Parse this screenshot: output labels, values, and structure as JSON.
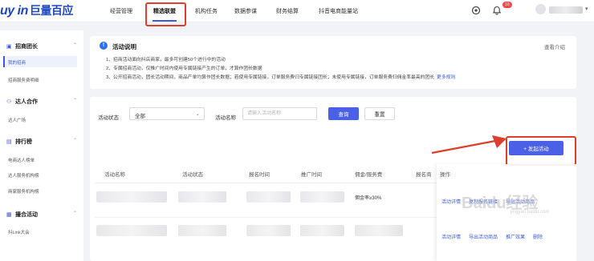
{
  "brand": {
    "logo_text": "uy in",
    "logo_cn": "巨量百应"
  },
  "nav": {
    "items": [
      {
        "label": "经营管理"
      },
      {
        "label": "精选联盟"
      },
      {
        "label": "机构任务"
      },
      {
        "label": "数据参谋"
      },
      {
        "label": "财务结算"
      },
      {
        "label": "抖音电商能量站"
      }
    ],
    "active_index": 1
  },
  "header": {
    "icons": [
      "target-icon",
      "bell-icon"
    ],
    "badge": "10",
    "avatar_icon": "user-icon"
  },
  "sidebar": {
    "groups": [
      {
        "icon": "user-group-icon",
        "label": "招商团长",
        "items": [
          "我的招商",
          "招商服务费明细"
        ]
      },
      {
        "icon": "handshake-icon",
        "label": "达人合作",
        "items": [
          "达人广场"
        ]
      },
      {
        "icon": "ranking-icon",
        "label": "排行榜",
        "items": [
          "电商达人榜单",
          "达人服务机构榜",
          "商家服务机构榜"
        ]
      },
      {
        "icon": "match-icon",
        "label": "撮合活动",
        "items": [
          "抖Link大会"
        ]
      }
    ],
    "active_item": "我的招商"
  },
  "notice": {
    "title": "活动说明",
    "right_link": "查看介绍",
    "lines": [
      "1、招商活动面向抖店商家，最多可创建50个进行中的活动",
      "2、专属招商活动，仅推广时间内使用专属链接产生的订单，才算作团长数据",
      "3、公开招商活动，团长活动期间，商品产单均算作团长数据；若使用专属链接，订单服务费归专属链接团长；未使用专属链接，订单服务费归佣金率最高的团长"
    ],
    "more_link": "更多规则"
  },
  "filter": {
    "status_label": "活动状态",
    "status_value": "全部",
    "name_label": "活动名称",
    "name_placeholder": "请输入活动名称",
    "query_button": "查询",
    "reset_button": "重置"
  },
  "launch_button": "+ 发起活动",
  "table": {
    "columns": [
      "活动名称",
      "活动状态",
      "报名时间",
      "推广时间",
      "佣金/服务费",
      "报名商",
      "操作"
    ],
    "rows": [
      {
        "commission": "佣金率≥30%",
        "actions": [
          "活动详情",
          "复制报名链接",
          "导出活动商品"
        ]
      },
      {
        "commission": "",
        "actions": [
          "活动详情",
          "导出活动商品",
          "推广效果",
          "删除"
        ]
      }
    ]
  },
  "watermark": {
    "text": "Baidu经验",
    "sub": "jingyan.baidu.com"
  }
}
